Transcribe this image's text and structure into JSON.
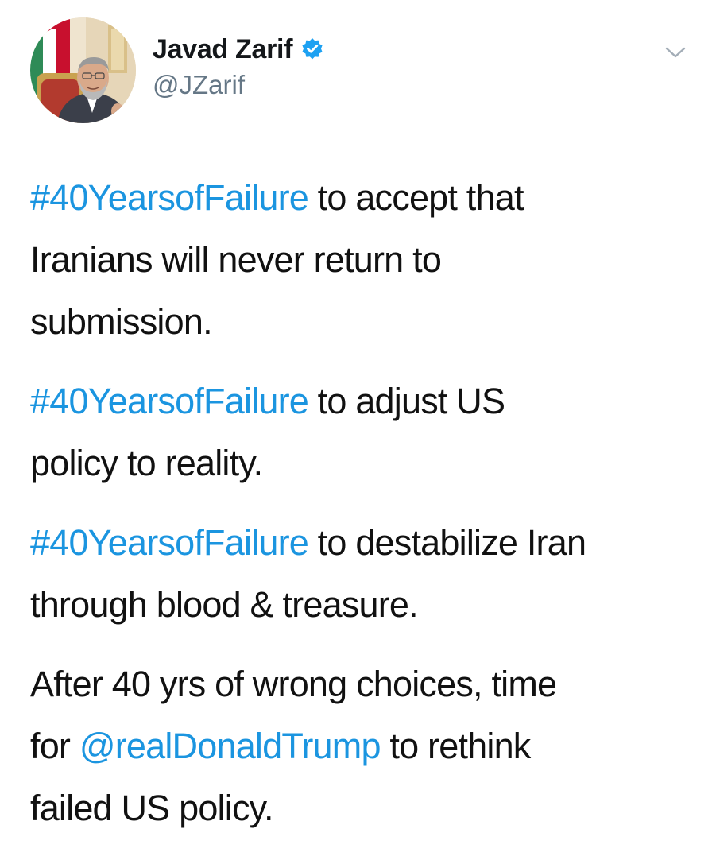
{
  "tweet": {
    "author": {
      "display_name": "Javad Zarif",
      "handle": "@JZarif",
      "verified": true,
      "avatar_icon": "profile-photo"
    },
    "menu_icon": "chevron-down-icon",
    "link_color": "#1b95e0",
    "paragraphs": [
      {
        "line1_tag": "#40YearsofFailure",
        "line1_rest": " to accept that",
        "line2": "Iranians will never return to",
        "line3": "submission."
      },
      {
        "line1_tag": "#40YearsofFailure",
        "line1_rest": " to adjust US",
        "line2": "policy to reality."
      },
      {
        "line1_tag": "#40YearsofFailure",
        "line1_rest": " to destabilize Iran",
        "line2": "through blood & treasure."
      },
      {
        "line1": "After 40 yrs of wrong choices, time",
        "line2_pre": "for ",
        "line2_mention": "@realDonaldTrump",
        "line2_post": " to rethink",
        "line3": "failed US policy."
      }
    ]
  }
}
